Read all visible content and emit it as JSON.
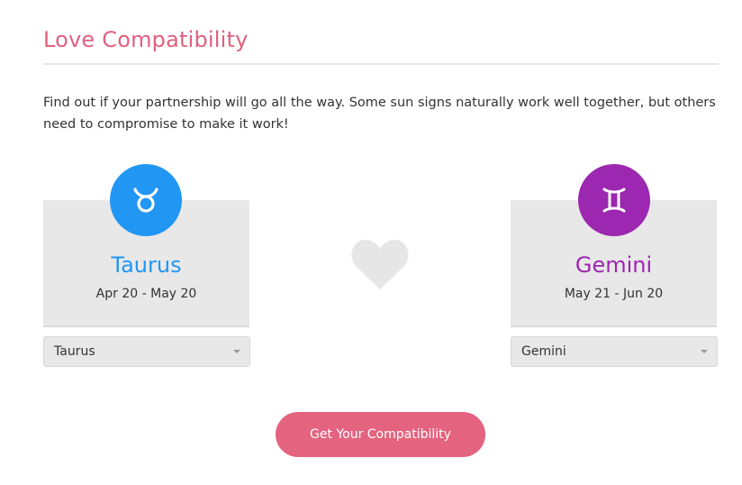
{
  "page": {
    "title": "Love Compatibility",
    "intro": "Find out if your partnership will go all the way. Some sun signs naturally work well together, but others need to compromise to make it work!"
  },
  "colors": {
    "title": "#e0607e",
    "button": "#e4637f",
    "taurus": "#2196f3",
    "gemini": "#9c27b0",
    "heart": "#e6e6e6"
  },
  "left_sign": {
    "icon": "taurus-icon",
    "name": "Taurus",
    "dates": "Apr 20 - May 20",
    "selected": "Taurus"
  },
  "right_sign": {
    "icon": "gemini-icon",
    "name": "Gemini",
    "dates": "May 21 - Jun 20",
    "selected": "Gemini"
  },
  "center": {
    "icon": "heart-icon"
  },
  "cta": {
    "label": "Get Your Compatibility"
  }
}
